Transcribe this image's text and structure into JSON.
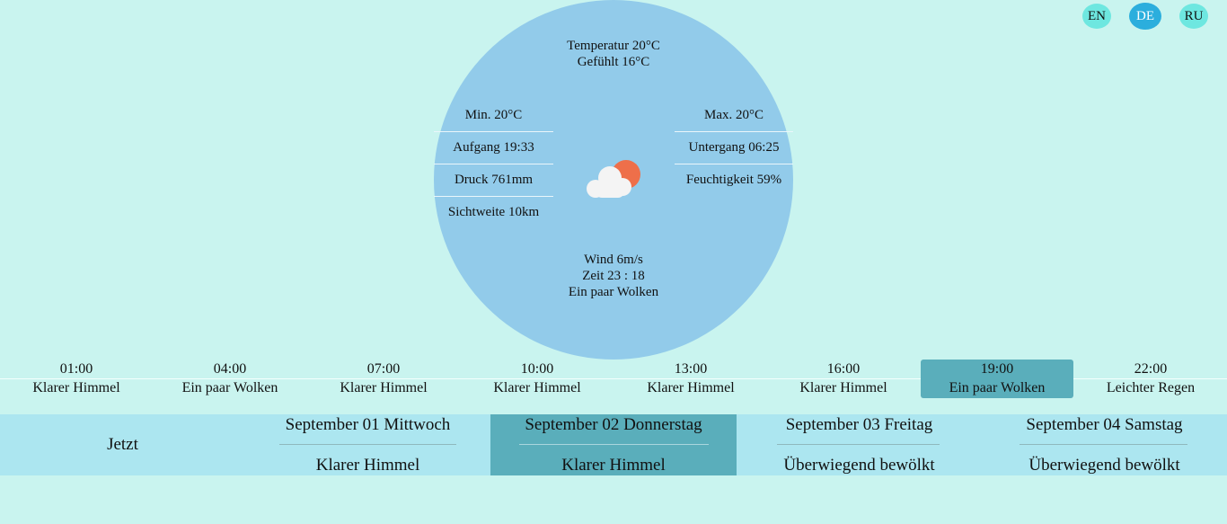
{
  "languages": [
    "EN",
    "DE",
    "RU"
  ],
  "active_language": "DE",
  "current": {
    "temperature": "Temperatur 20°C",
    "feels_like": "Gefühlt 16°C",
    "min": "Min. 20°C",
    "max": "Max. 20°C",
    "sunrise": "Aufgang 19:33",
    "sunset": "Untergang 06:25",
    "pressure": "Druck 761mm",
    "humidity": "Feuchtigkeit 59%",
    "visibility": "Sichtweite 10km",
    "wind": "Wind 6m/s",
    "time": "Zeit 23 : 18",
    "description": "Ein paar Wolken",
    "icon": "partly-cloudy-icon"
  },
  "hourly": [
    {
      "time": "01:00",
      "desc": "Klarer Himmel"
    },
    {
      "time": "04:00",
      "desc": "Ein paar Wolken"
    },
    {
      "time": "07:00",
      "desc": "Klarer Himmel"
    },
    {
      "time": "10:00",
      "desc": "Klarer Himmel"
    },
    {
      "time": "13:00",
      "desc": "Klarer Himmel"
    },
    {
      "time": "16:00",
      "desc": "Klarer Himmel"
    },
    {
      "time": "19:00",
      "desc": "Ein paar Wolken"
    },
    {
      "time": "22:00",
      "desc": "Leichter Regen"
    }
  ],
  "hourly_active_index": 6,
  "daily": {
    "now_label": "Jetzt",
    "days": [
      {
        "date": "September 01 Mittwoch",
        "desc": "Klarer Himmel"
      },
      {
        "date": "September 02 Donnerstag",
        "desc": "Klarer Himmel"
      },
      {
        "date": "September 03 Freitag",
        "desc": "Überwiegend bewölkt"
      },
      {
        "date": "September 04 Samstag",
        "desc": "Überwiegend bewölkt"
      }
    ],
    "active_index": 1
  },
  "colors": {
    "background": "#c9f4ef",
    "circle": "#92cbea",
    "accent": "#5aaebb",
    "daily_bar": "#ace6f0",
    "lang_active": "#2baedd",
    "lang_inactive": "#6ee7e0",
    "sun": "#ee6f4a"
  }
}
